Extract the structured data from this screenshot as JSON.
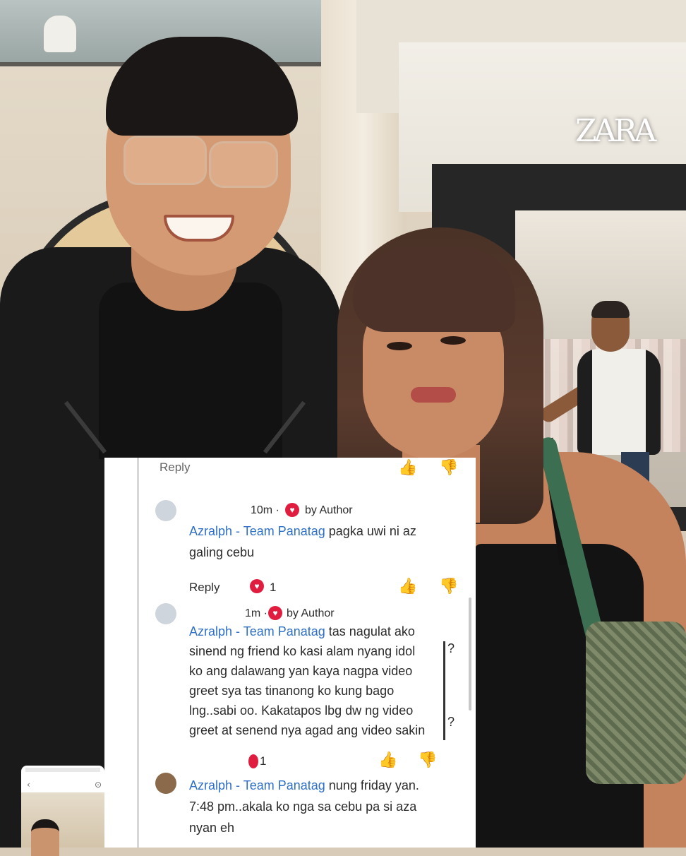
{
  "background": {
    "store_logo": "ZARA"
  },
  "comments": {
    "top_action": {
      "reply_label": "Reply"
    },
    "comment1": {
      "time": "10m ·",
      "author_badge": "by Author",
      "name": "Azralph - Team Panatag",
      "line1_rest": " pagka uwi ni az",
      "line2": "galing cebu",
      "reply_label": "Reply",
      "heart_count": "1"
    },
    "comment2": {
      "time": "1m ·",
      "author_badge": "by Author",
      "name": "Azralph - Team Panatag",
      "line1_rest": " tas nagulat ako",
      "line2": "sinend ng friend ko kasi alam nyang idol",
      "line3": "ko ang dalawang yan kaya nagpa video",
      "line4": "greet sya tas tinanong ko kung bago",
      "line5": "lng..sabi oo. Kakatapos lbg dw ng video",
      "line6": "greet at senend nya agad ang video sakin",
      "side_mark_top": "?",
      "side_mark_bottom": "?",
      "count_partial": "1"
    },
    "comment3": {
      "name": "Azralph - Team Panatag",
      "line1_rest": " nung friday yan.",
      "line2": "7:48 pm..akala ko nga sa cebu pa si aza",
      "line3": "nyan eh"
    }
  },
  "icons": {
    "heart": "heart-icon",
    "like": "thumbs-up-icon",
    "dislike": "thumbs-down-icon",
    "back": "chevron-left-icon"
  },
  "colors": {
    "name_link": "#2e6fc7",
    "heart": "#e11d3f"
  }
}
